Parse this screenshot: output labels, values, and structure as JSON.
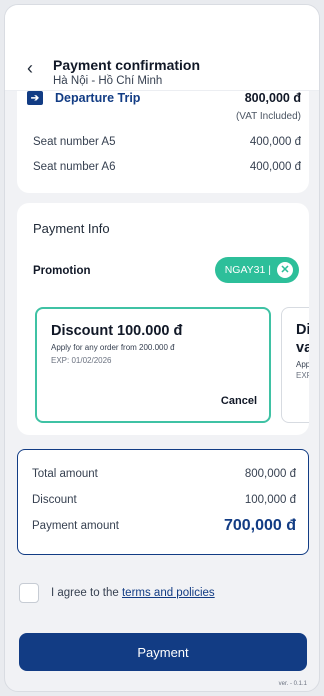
{
  "header": {
    "back_icon": "chevron-left-icon",
    "title": "Payment confirmation",
    "route": "Hà Nội - Hồ Chí Minh"
  },
  "trip": {
    "icon": "departure-arrow-icon",
    "label": "Departure Trip",
    "price": "800,000 đ",
    "vat_note": "(VAT Included)",
    "seats": [
      {
        "label": "Seat number A5",
        "price": "400,000 đ"
      },
      {
        "label": "Seat number A6",
        "price": "400,000 đ"
      }
    ]
  },
  "payment_info": {
    "title": "Payment Info",
    "promotion_label": "Promotion",
    "promo_code": "NGAY31 |",
    "vouchers": [
      {
        "title": "Discount 100.000 đ",
        "desc": "Apply for any order from 200.000 đ",
        "exp": "EXP: 01/02/2026",
        "action": "Cancel",
        "selected": true
      },
      {
        "title": "Dis",
        "title2": "val",
        "desc": "App",
        "exp": "EXP",
        "selected": false
      }
    ]
  },
  "totals": {
    "total_label": "Total amount",
    "total_value": "800,000 đ",
    "discount_label": "Discount",
    "discount_value": "100,000 đ",
    "payment_label": "Payment amount",
    "payment_value": "700,000 đ"
  },
  "agree": {
    "prefix": "I agree to the",
    "link": "terms and policies"
  },
  "pay_button": "Payment",
  "version": "ver. - 0.1.1",
  "colors": {
    "primary": "#123c84",
    "accent": "#2dbf9a"
  }
}
